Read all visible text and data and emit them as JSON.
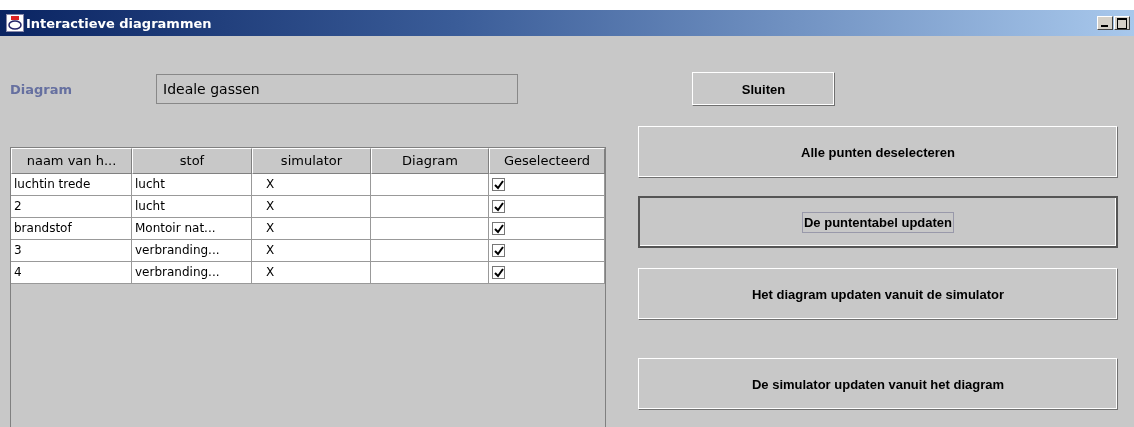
{
  "window": {
    "title": "Interactieve diagrammen"
  },
  "diagram": {
    "label": "Diagram",
    "value": "Ideale gassen"
  },
  "table": {
    "columns": [
      "naam van h...",
      "stof",
      "simulator",
      "Diagram",
      "Geselecteerd"
    ],
    "rows": [
      {
        "name": "luchtin trede",
        "stof": "lucht",
        "simulator": "X",
        "checked": true
      },
      {
        "name": "2",
        "stof": "lucht",
        "simulator": "X",
        "checked": true
      },
      {
        "name": "brandstof",
        "stof": "Montoir nat...",
        "simulator": "X",
        "checked": true
      },
      {
        "name": "3",
        "stof": "verbranding...",
        "simulator": "X",
        "checked": true
      },
      {
        "name": "4",
        "stof": "verbranding...",
        "simulator": "X",
        "checked": true
      }
    ]
  },
  "close_button": "Sluiten",
  "buttons": [
    {
      "label": "Alle punten deselecteren",
      "focused": false
    },
    {
      "label": "De puntentabel updaten",
      "focused": true
    },
    {
      "label": "Het diagram updaten vanuit de simulator",
      "focused": false
    },
    {
      "label": "De simulator updaten vanuit het diagram",
      "focused": false
    }
  ]
}
